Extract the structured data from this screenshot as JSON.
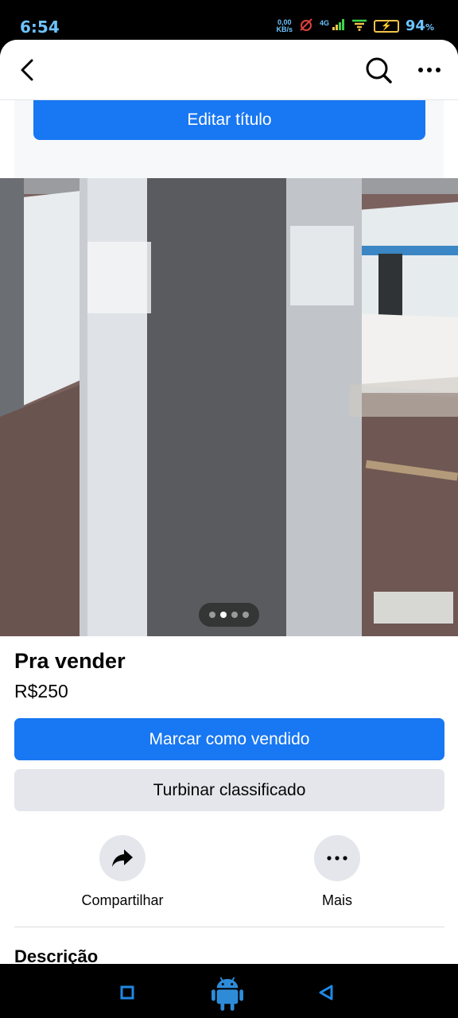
{
  "status_bar": {
    "time": "6:54",
    "net_speed_value": "0,00",
    "net_speed_unit": "KB/s",
    "network_type": "4G",
    "battery_percent": "94",
    "battery_percent_sign": "%"
  },
  "edit_card": {
    "edit_title_label": "Editar título"
  },
  "carousel": {
    "total": 4,
    "active_index": 1
  },
  "listing": {
    "title": "Pra vender",
    "price": "R$250"
  },
  "buttons": {
    "mark_sold": "Marcar como vendido",
    "boost": "Turbinar classificado"
  },
  "actions": {
    "share_label": "Compartilhar",
    "more_label": "Mais"
  },
  "description": {
    "heading": "Descrição"
  },
  "colors": {
    "accent": "#1877f2",
    "secondary_bg": "#e4e6eb",
    "status_text": "#6ec3ff",
    "battery": "#f3c34a"
  }
}
